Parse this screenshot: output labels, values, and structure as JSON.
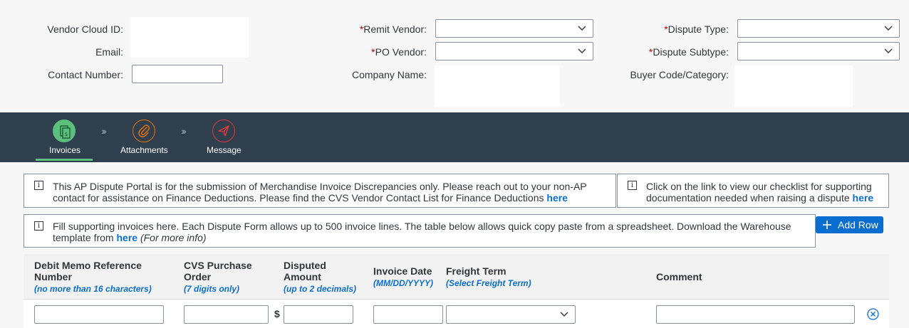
{
  "header": {
    "vendor_cloud_id_label": "Vendor Cloud ID:",
    "email_label": "Email:",
    "contact_number_label": "Contact Number:",
    "remit_vendor_label": "Remit Vendor:",
    "po_vendor_label": "PO Vendor:",
    "company_name_label": "Company Name:",
    "dispute_type_label": "Dispute Type:",
    "dispute_subtype_label": "Dispute Subtype:",
    "buyer_code_label": "Buyer Code/Category:",
    "required_marker": "*"
  },
  "steps": [
    {
      "label": "Invoices",
      "icon": "invoice-icon",
      "color": "#5cbf7d",
      "active": true
    },
    {
      "label": "Attachments",
      "icon": "paperclip-icon",
      "color": "#e9730c",
      "active": false
    },
    {
      "label": "Message",
      "icon": "paper-plane-icon",
      "color": "#e0393c",
      "active": false
    }
  ],
  "info": {
    "portal_text": "This AP Dispute Portal is for the submission of Merchandise Invoice Discrepancies only. Please reach out to your non-AP contact for assistance on Finance Deductions. Please find the CVS Vendor Contact List for Finance Deductions",
    "portal_link": "here",
    "checklist_text": "Click on the link to view our checklist for supporting documentation needed when raising a dispute",
    "checklist_link": "here",
    "fill_text": "Fill supporting invoices here. Each Dispute Form allows up to 500 invoice lines. The table below allows quick copy paste from a spreadsheet. Download the Warehouse template from",
    "fill_link": "here",
    "fill_more": "(For more info)"
  },
  "add_row_label": "Add Row",
  "table": {
    "columns": [
      {
        "title": "Debit Memo Reference Number",
        "hint": "(no more than 16 characters)"
      },
      {
        "title": "CVS Purchase Order",
        "hint": "(7 digits only)"
      },
      {
        "title": "Disputed Amount",
        "hint": "(up to 2 decimals)"
      },
      {
        "title": "Invoice Date",
        "hint": "(MM/DD/YYYY)"
      },
      {
        "title": "Freight Term",
        "hint": "(Select Freight Term)"
      },
      {
        "title": "Comment",
        "hint": ""
      }
    ],
    "currency_symbol": "$"
  },
  "colors": {
    "accent": "#0a6ed1",
    "nav_bg": "#2f3f4d",
    "required": "#bb0000"
  }
}
